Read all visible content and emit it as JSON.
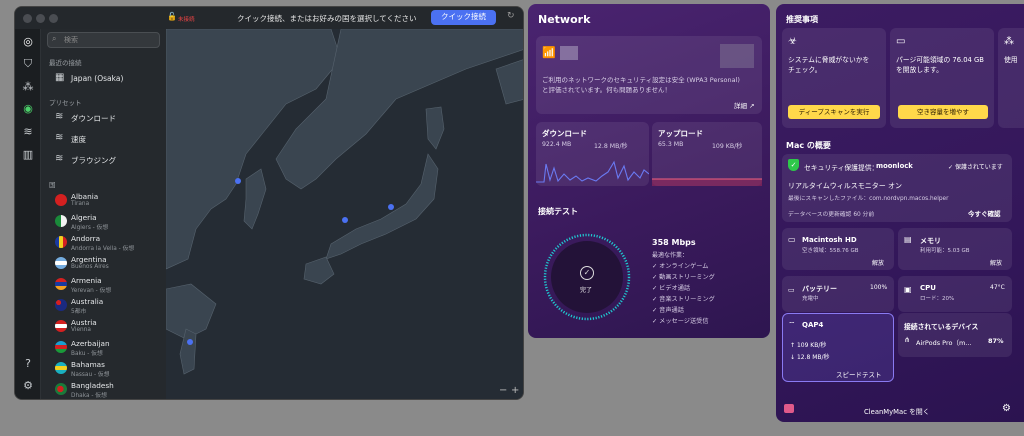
{
  "vpn": {
    "status": "未接続",
    "title": "クイック接続、またはお好みの国を選択してください",
    "quick_connect_btn": "クイック接続",
    "search_placeholder": "検索",
    "recent_label": "最近の接続",
    "recent_item": "Japan (Osaka)",
    "presets_label": "プリセット",
    "presets": [
      "ダウンロード",
      "速度",
      "ブラウジング"
    ],
    "countries_label": "国",
    "countries": [
      {
        "name": "Albania",
        "city": "Tirana"
      },
      {
        "name": "Algeria",
        "city": "Algiers - 仮想"
      },
      {
        "name": "Andorra",
        "city": "Andorra la Vella - 仮想"
      },
      {
        "name": "Argentina",
        "city": "Buenos Aires"
      },
      {
        "name": "Armenia",
        "city": "Yerevan - 仮想"
      },
      {
        "name": "Australia",
        "city": "5都市"
      },
      {
        "name": "Austria",
        "city": "Vienna"
      },
      {
        "name": "Azerbaijan",
        "city": "Baku - 仮想"
      },
      {
        "name": "Bahamas",
        "city": "Nassau - 仮想"
      },
      {
        "name": "Bangladesh",
        "city": "Dhaka - 仮想"
      }
    ],
    "zoom_out": "−",
    "zoom_in": "+"
  },
  "network": {
    "title": "Network",
    "security_text_1": "ご利用のネットワークのセキュリティ設定は安全 (WPA3 Personal)",
    "security_text_2": "と評価されています。何も問題ありません！",
    "details": "詳細 ↗",
    "download": {
      "label": "ダウンロード",
      "total": "922.4 MB",
      "rate": "12.8 MB/秒"
    },
    "upload": {
      "label": "アップロード",
      "total": "65.3 MB",
      "rate": "109 KB/秒"
    },
    "speedtest": {
      "title": "接続テスト",
      "done": "完了",
      "speed": "358 Mbps",
      "subtitle": "最適な作業：",
      "items": [
        "オンラインゲーム",
        "動画ストリーミング",
        "ビデオ通話",
        "音楽ストリーミング",
        "音声通話",
        "メッセージ送受信"
      ]
    }
  },
  "cmm": {
    "recommend_title": "推奨事項",
    "rec1_text_1": "システムに脅威がないかを",
    "rec1_text_2": "チェック。",
    "rec1_btn": "ディープスキャンを実行",
    "rec2_text_1": "パージ可能領域の 76.04 GB",
    "rec2_text_2": "を開放します。",
    "rec2_btn": "空き容量を増やす",
    "rec3_text": "使用",
    "overview_title": "Mac の概要",
    "security_label": "セキュリティ保護提供：",
    "moonlock": "moonlock",
    "protected": "保護されています",
    "realtime": "リアルタイムウィルスモニター オン",
    "last_scan": "最後にスキャンしたファイル：com.nordvpn.macos.helper",
    "db_update": "データベースの更新確認 60 分前",
    "check_now": "今すぐ確認",
    "disk": {
      "title": "Macintosh HD",
      "free": "空き領域：558.76 GB",
      "action": "解放"
    },
    "memory": {
      "title": "メモリ",
      "used": "利用可能：5.03 GB",
      "action": "解放"
    },
    "battery": {
      "title": "バッテリー",
      "pct": "100%",
      "status": "充電中"
    },
    "cpu": {
      "title": "CPU",
      "temp": "47°C",
      "load": "ロード：20%"
    },
    "wifi": {
      "name": "QAP4",
      "up": "109 KB/秒",
      "down": "12.8 MB/秒",
      "btn": "スピードテスト"
    },
    "devices": {
      "title": "接続されているデバイス",
      "name": "AirPods Pro（m...",
      "pct": "87%"
    },
    "open_btn": "CleanMyMac を開く"
  }
}
